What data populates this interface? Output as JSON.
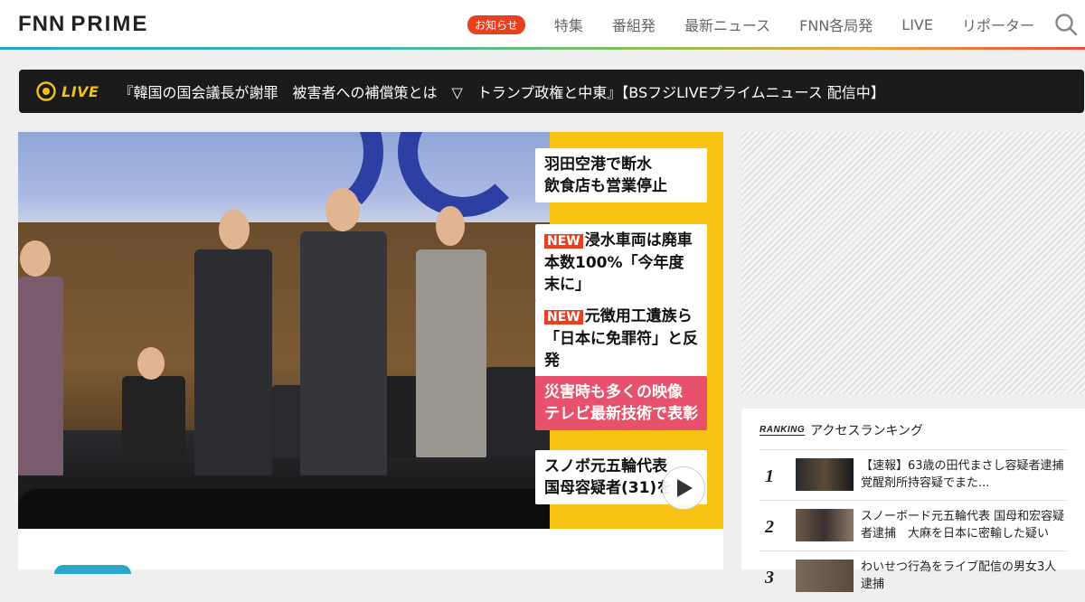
{
  "header": {
    "logo_fnn": "FNN",
    "logo_prime": "PRIME",
    "notice_badge": "お知らせ",
    "nav": [
      "特集",
      "番組発",
      "最新ニュース",
      "FNN各局発",
      "LIVE",
      "リポーター"
    ]
  },
  "live": {
    "label": "LIVE",
    "text": "『韓国の国会議長が謝罪　被害者への補償策とは　▽　トランプ政権と中東』【BSフジLIVEプライムニュース 配信中】"
  },
  "hero": {
    "headlines": [
      {
        "new": "",
        "line1": "羽田空港で断水",
        "line2": "飲食店も営業停止"
      },
      {
        "new": "NEW",
        "line1": "浸水車両は廃車",
        "line2": "本数100%「今年度末に」"
      },
      {
        "new": "NEW",
        "line1": "元徴用工遺族ら",
        "line2": "「日本に免罪符」と反発"
      },
      {
        "new": "",
        "line1": "災害時も多くの映像",
        "line2": "テレビ最新技術で表彰"
      },
      {
        "new": "",
        "line1": "スノボ元五輪代表",
        "line2": "国母容疑者(31)を"
      }
    ]
  },
  "ranking": {
    "tag": "RANKING",
    "title": "アクセスランキング",
    "items": [
      {
        "num": "1",
        "text": "【速報】63歳の田代まさし容疑者逮捕　覚醒剤所持容疑でまた..."
      },
      {
        "num": "2",
        "text": "スノーボード元五輪代表 国母和宏容疑者逮捕　大麻を日本に密輸した疑い"
      },
      {
        "num": "3",
        "text": "わいせつ行為をライブ配信の男女3人逮捕"
      }
    ]
  },
  "colors": {
    "accent_live": "#f3c218",
    "notice": "#e8411f",
    "headline_panel": "#f8c313"
  }
}
